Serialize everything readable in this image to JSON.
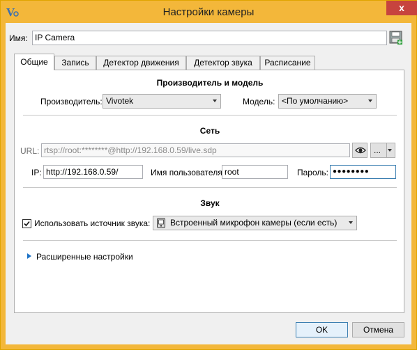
{
  "window": {
    "title": "Настройки камеры",
    "close_glyph": "x"
  },
  "name_row": {
    "label": "Имя:",
    "value": "IP Camera"
  },
  "tabs": [
    {
      "label": "Общие",
      "active": true
    },
    {
      "label": "Запись",
      "active": false
    },
    {
      "label": "Детектор движения",
      "active": false
    },
    {
      "label": "Детектор звука",
      "active": false
    },
    {
      "label": "Расписание",
      "active": false
    }
  ],
  "vendor": {
    "heading": "Производитель и модель",
    "manufacturer_label": "Производитель:",
    "manufacturer_value": "Vivotek",
    "model_label": "Модель:",
    "model_value": "<По умолчанию>"
  },
  "network": {
    "heading": "Сеть",
    "url_label": "URL:",
    "url_value": "rtsp://root:********@http://192.168.0.59/live.sdp",
    "more_label": "...",
    "ip_label": "IP:",
    "ip_value": "http://192.168.0.59/",
    "user_label": "Имя пользователя:",
    "user_value": "root",
    "password_label": "Пароль:",
    "password_value": "●●●●●●●●"
  },
  "sound": {
    "heading": "Звук",
    "use_source_label": "Использовать источник звука:",
    "use_source_checked": true,
    "source_value": "Встроенный микрофон камеры (если есть)"
  },
  "advanced": {
    "label": "Расширенные настройки"
  },
  "footer": {
    "ok_label": "OK",
    "cancel_label": "Отмена"
  },
  "colors": {
    "title_bar": "#f3b73a",
    "close": "#c7433e",
    "focus_border": "#3c7fb1"
  }
}
